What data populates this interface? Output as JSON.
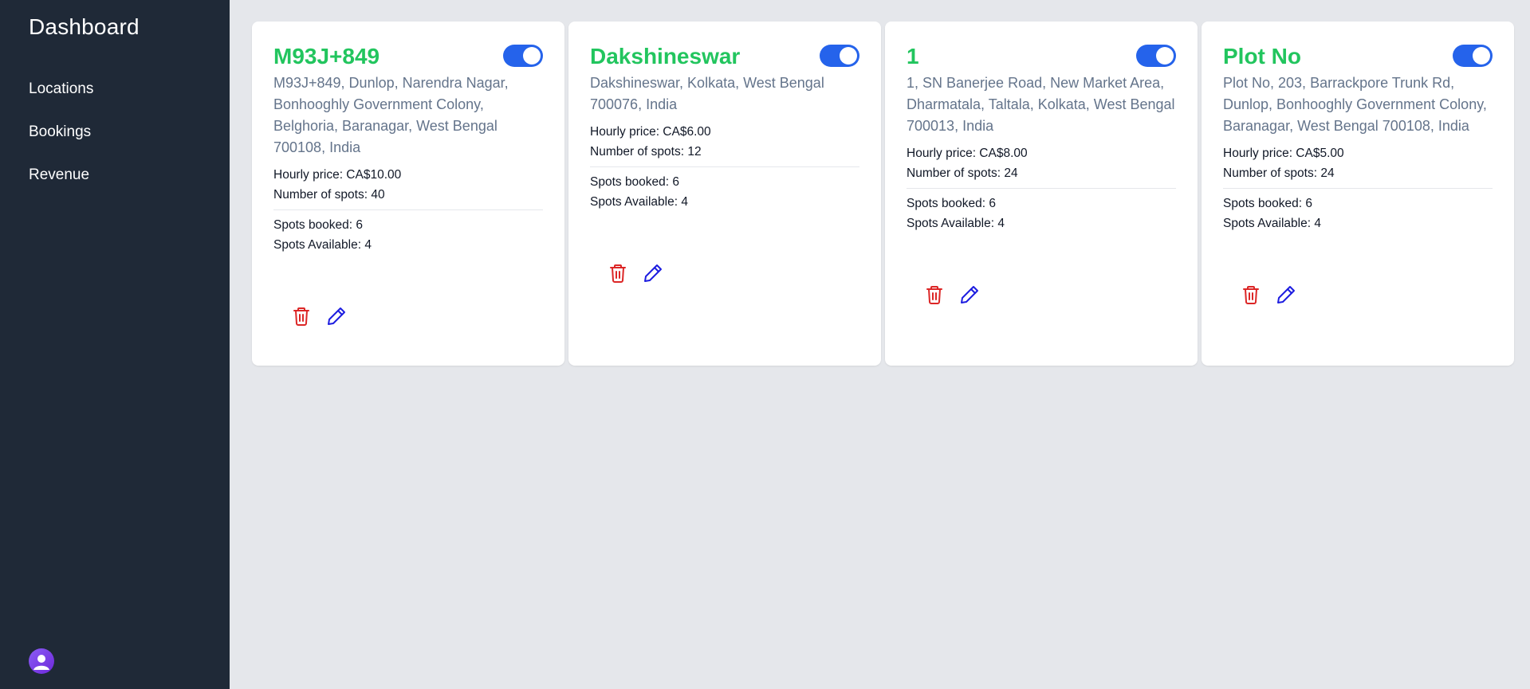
{
  "sidebar": {
    "title": "Dashboard",
    "items": [
      {
        "label": "Locations"
      },
      {
        "label": "Bookings"
      },
      {
        "label": "Revenue"
      }
    ]
  },
  "colors": {
    "accent_green": "#22c55e",
    "toggle_blue": "#2563eb",
    "delete_red": "#dc2626",
    "edit_blue": "#1d1de0",
    "sidebar_bg": "#1f2937"
  },
  "cards": [
    {
      "name": "M93J+849",
      "address": "M93J+849, Dunlop, Narendra Nagar, Bonhooghly Government Colony, Belghoria, Baranagar, West Bengal 700108, India",
      "hourly_price": "Hourly price: CA$10.00",
      "spots": "Number of spots: 40",
      "booked": "Spots booked: 6",
      "available": "Spots Available: 4",
      "active": true
    },
    {
      "name": "Dakshineswar",
      "address": "Dakshineswar, Kolkata, West Bengal 700076, India",
      "hourly_price": "Hourly price: CA$6.00",
      "spots": "Number of spots: 12",
      "booked": "Spots booked: 6",
      "available": "Spots Available: 4",
      "active": true
    },
    {
      "name": "1",
      "address": "1, SN Banerjee Road, New Market Area, Dharmatala, Taltala, Kolkata, West Bengal 700013, India",
      "hourly_price": "Hourly price: CA$8.00",
      "spots": "Number of spots: 24",
      "booked": "Spots booked: 6",
      "available": "Spots Available: 4",
      "active": true
    },
    {
      "name": "Plot No",
      "address": "Plot No, 203, Barrackpore Trunk Rd, Dunlop, Bonhooghly Government Colony, Baranagar, West Bengal 700108, India",
      "hourly_price": "Hourly price: CA$5.00",
      "spots": "Number of spots: 24",
      "booked": "Spots booked: 6",
      "available": "Spots Available: 4",
      "active": true
    }
  ]
}
